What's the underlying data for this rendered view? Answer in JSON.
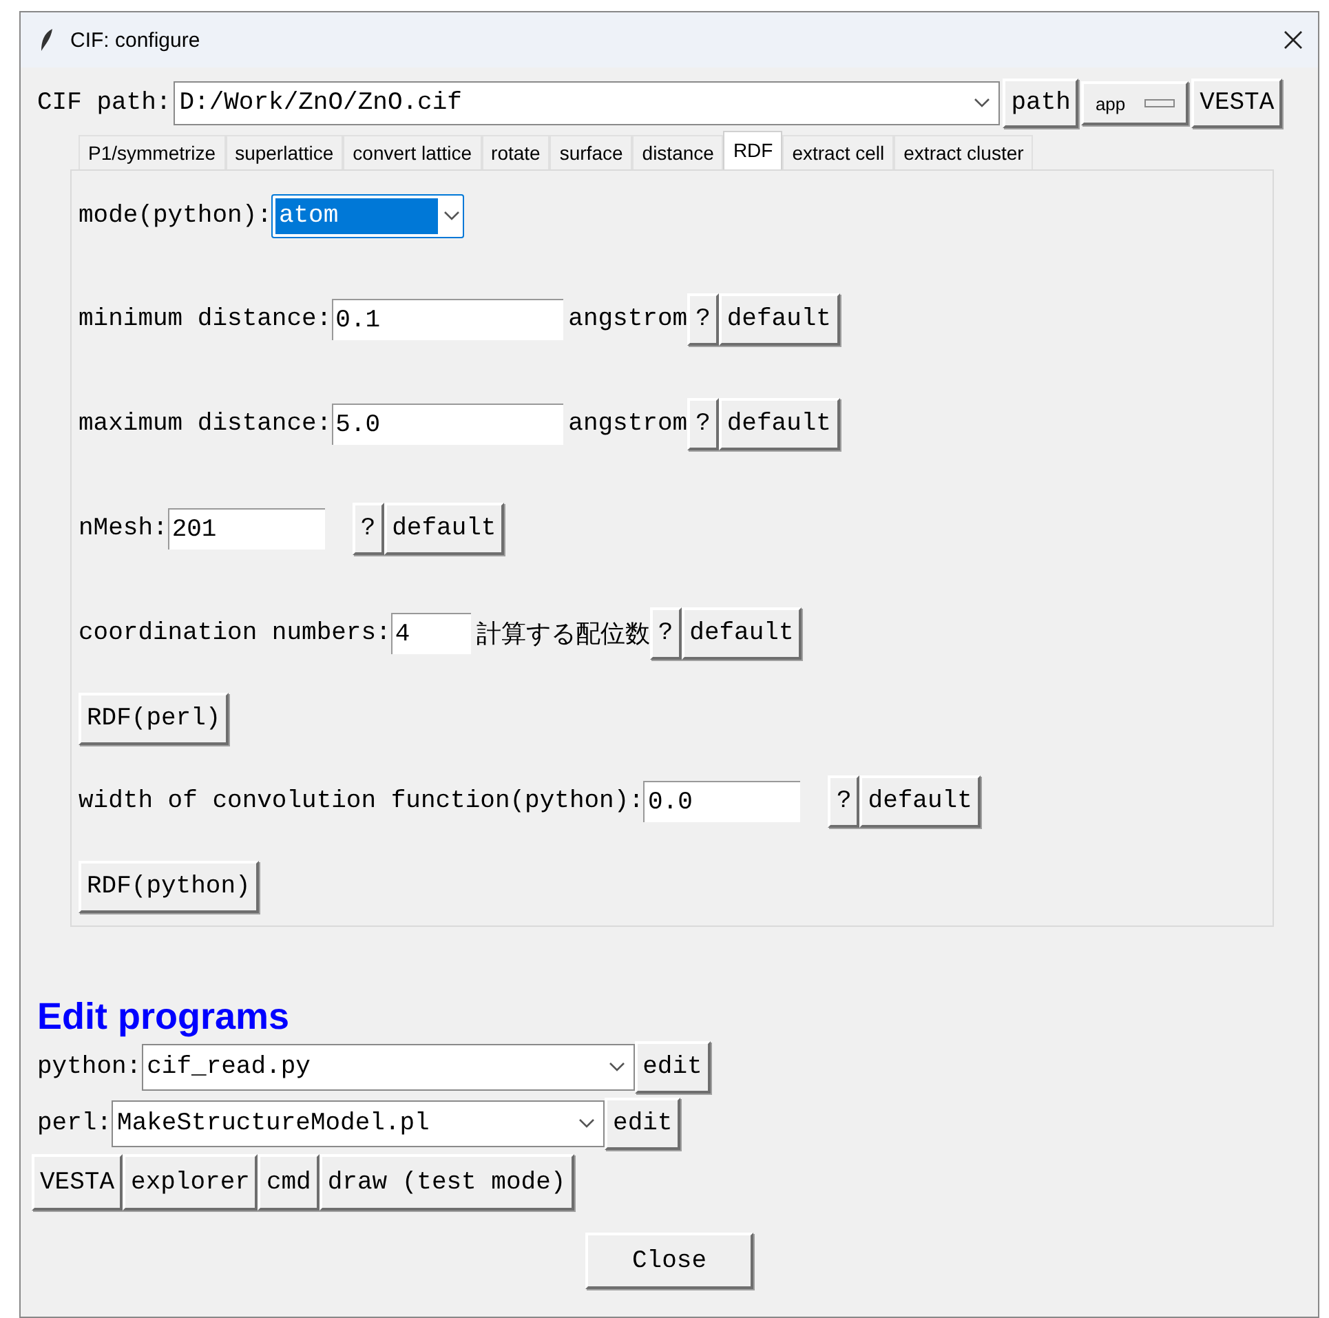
{
  "window": {
    "title": "CIF: configure"
  },
  "cif_path": {
    "label": "CIF path:",
    "value": "D:/Work/ZnO/ZnO.cif",
    "buttons": [
      {
        "kind": "button",
        "label": "path"
      },
      {
        "kind": "menu",
        "label": "app"
      },
      {
        "kind": "button",
        "label": "VESTA"
      }
    ]
  },
  "tabs": [
    {
      "label": "P1/symmetrize",
      "selected": false
    },
    {
      "label": "superlattice",
      "selected": false
    },
    {
      "label": "convert lattice",
      "selected": false
    },
    {
      "label": "rotate",
      "selected": false
    },
    {
      "label": "surface",
      "selected": false
    },
    {
      "label": "distance",
      "selected": false
    },
    {
      "label": "RDF",
      "selected": true
    },
    {
      "label": "extract cell",
      "selected": false
    },
    {
      "label": "extract cluster",
      "selected": false
    }
  ],
  "tab_panel": {
    "rows": [
      {
        "kind": "select",
        "label": "mode(python):",
        "value": "atom",
        "highlighted": true
      },
      {
        "kind": "field",
        "label": "minimum distance:",
        "value": "0.1",
        "unit": "angstrom",
        "help": "?",
        "button": "default"
      },
      {
        "kind": "field",
        "label": "maximum distance:",
        "value": "5.0",
        "unit": "angstrom",
        "help": "?",
        "button": "default"
      },
      {
        "kind": "field",
        "label": "nMesh:",
        "value": "201",
        "help": "?",
        "button": "default"
      },
      {
        "kind": "field",
        "label": "coordination numbers:",
        "value": "4",
        "unit": "計算する配位数",
        "help": "?",
        "button": "default"
      },
      {
        "kind": "button",
        "label": "RDF(perl)"
      },
      {
        "kind": "field",
        "label": "width of convolution function(python):",
        "value": "0.0",
        "help": "?",
        "button": "default"
      },
      {
        "kind": "button",
        "label": "RDF(python)"
      }
    ]
  },
  "edit_programs": {
    "heading": "Edit programs",
    "programs": [
      {
        "label": "python:",
        "value": "cif_read.py",
        "button": "edit"
      },
      {
        "label": "perl:",
        "value": "MakeStructureModel.pl",
        "button": "edit"
      }
    ],
    "buttons": [
      "VESTA",
      "explorer",
      "cmd",
      "draw (test mode)"
    ]
  },
  "close_button": "Close"
}
